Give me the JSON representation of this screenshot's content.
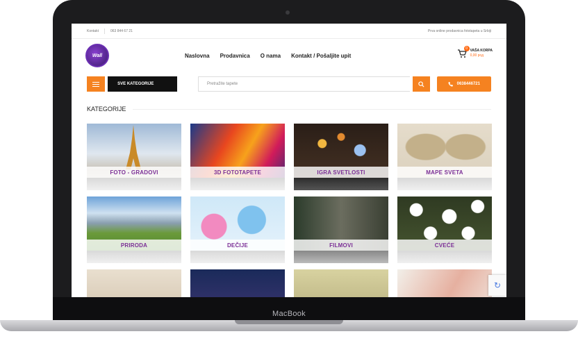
{
  "device": {
    "brand_label": "MacBook"
  },
  "topbar": {
    "contact_label": "Kontakt",
    "phone": "063 844 67 21",
    "tagline": "Prva online prodavnica fototapeta u Srbiji"
  },
  "logo": {
    "text": "Wall"
  },
  "nav": {
    "items": [
      {
        "label": "Naslovna"
      },
      {
        "label": "Prodavnica"
      },
      {
        "label": "O nama"
      },
      {
        "label": "Kontakt / Pošaljite upit"
      }
    ]
  },
  "cart": {
    "count": "0",
    "label": "VAŠA KORPA",
    "price": "0,00 рсд"
  },
  "searchbar": {
    "categories_label": "SVE KATEGORIJE",
    "placeholder": "Pretražite tapete",
    "phone_button": "0638446721"
  },
  "section": {
    "title": "KATEGORIJE"
  },
  "categories": [
    {
      "label": "FOTO - GRADOVI"
    },
    {
      "label": "3D FOTOTAPETE"
    },
    {
      "label": "IGRA SVETLOSTI"
    },
    {
      "label": "MAPE SVETA"
    },
    {
      "label": "PRIRODA"
    },
    {
      "label": "DEČIJE"
    },
    {
      "label": "FILMOVI"
    },
    {
      "label": "CVEĆE"
    }
  ],
  "colors": {
    "accent": "#f58220",
    "label": "#7b2f96",
    "dark": "#111111"
  },
  "icons": [
    "hamburger-icon",
    "search-icon",
    "phone-icon",
    "cart-icon",
    "recaptcha-icon"
  ]
}
